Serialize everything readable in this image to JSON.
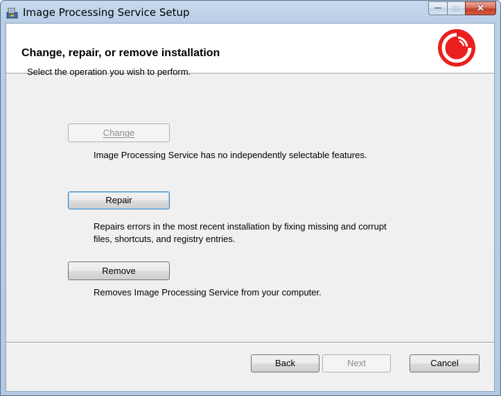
{
  "window": {
    "title": "Image Processing Service Setup",
    "caption_buttons": {
      "minimize_glyph": "—",
      "maximize_glyph": "□",
      "close_glyph": "✕"
    }
  },
  "header": {
    "title": "Change, repair, or remove installation",
    "subtitle": "Select the operation you wish to perform.",
    "logo_icon": "sitecore-logo-icon",
    "logo_color": "#eb1f1f"
  },
  "operations": {
    "change": {
      "label": "Change",
      "enabled": false,
      "description": "Image Processing Service has no independently selectable features."
    },
    "repair": {
      "label": "Repair",
      "enabled": true,
      "description_line1": "Repairs errors in the most recent installation by fixing missing and corrupt",
      "description_line2": "files, shortcuts, and registry entries."
    },
    "remove": {
      "label": "Remove",
      "enabled": true,
      "description": "Removes Image Processing Service from your computer."
    }
  },
  "footer": {
    "back_label": "Back",
    "next_label": "Next",
    "next_enabled": false,
    "cancel_label": "Cancel"
  }
}
